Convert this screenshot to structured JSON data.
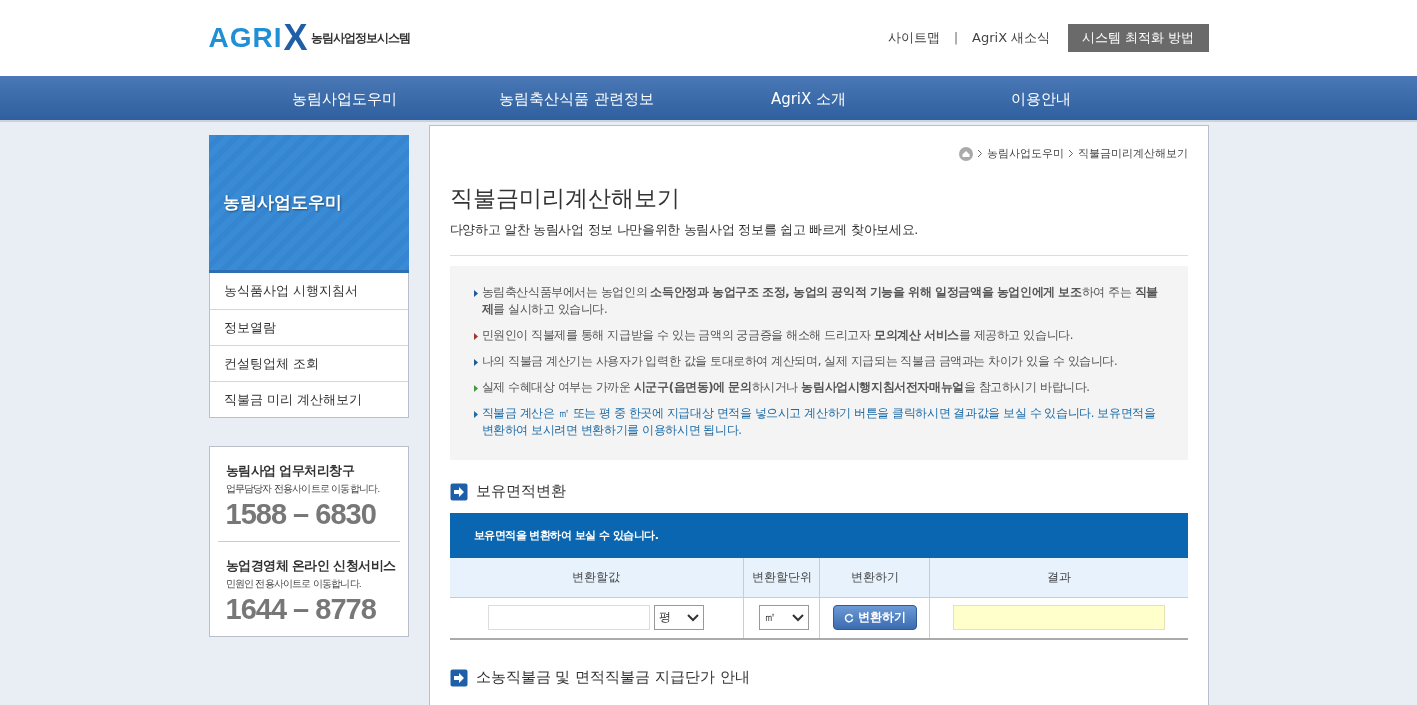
{
  "header": {
    "logo": {
      "wordmark": "AGRI",
      "x_letter": "X",
      "subtitle": "농림사업정보시스템"
    },
    "utility_links": [
      "사이트맵",
      "AgriX 새소식"
    ],
    "utility_separator": "|",
    "optimize_button": "시스템 최적화 방법"
  },
  "nav": [
    "농림사업도우미",
    "농림축산식품 관련정보",
    "AgriX 소개",
    "이용안내"
  ],
  "sidebar": {
    "title": "농림사업도우미",
    "items": [
      {
        "label": "농식품사업 시행지침서",
        "selected": false
      },
      {
        "label": "정보열람",
        "selected": false
      },
      {
        "label": "컨설팅업체 조회",
        "selected": false
      },
      {
        "label": "직불금 미리 계산해보기",
        "selected": false
      }
    ],
    "contacts": [
      {
        "title": "농림사업 업무처리창구",
        "subtitle": "업무담당자 전용사이트로 이동합니다.",
        "phone": "1588 – 6830"
      },
      {
        "title": "농업경영체 온라인 신청서비스",
        "subtitle": "민원인 전용사이트로 이동합니다.",
        "phone": "1644 – 8778"
      }
    ]
  },
  "breadcrumb": [
    "농림사업도우미",
    "직불금미리계산해보기"
  ],
  "page_title": "직불금미리계산해보기",
  "page_description": "다양하고 알찬 농림사업 정보 나만을위한 농림사업 정보를 쉽고 빠르게 찾아보세요.",
  "notes": [
    {
      "kind": "plain",
      "color": "#1d5a96",
      "text": "농림축산식품부에서는 농업인의 **소득안정과 농업구조 조정, 농업의 공익적 기능을 위해 일정금액을 농업인에게 보조**하여 주는 **직불제**를 실시하고 있습니다."
    },
    {
      "kind": "plain",
      "color": "#a5352c",
      "text": "민원인이 직불제를 통해 지급받을 수 있는 금액의 궁금증을 해소해 드리고자 **모의계산 서비스**를 제공하고 있습니다."
    },
    {
      "kind": "plain",
      "color": "#1d5a96",
      "text": "나의 직불금 계산기는 사용자가 입력한 값을 토대로하여 계산되며, 실제 지급되는 직불금 금액과는 차이가 있을 수 있습니다."
    },
    {
      "kind": "plain",
      "color": "#3f9a3a",
      "text": "실제 수혜대상 여부는 가까운 **시군구(읍면동)에 문의**하시거나 **농림사업시행지침서전자매뉴얼**을 참고하시기 바랍니다."
    },
    {
      "kind": "highlight",
      "color": "#1d6aa5",
      "text": "직불금 계산은 ㎡ 또는 평 중 한곳에 지급대상 면적을 넣으시고 계산하기 버튼을 클릭하시면 결과값을 보실 수 있습니다. 보유면적을 변환하여 보시려면 변환하기를 이용하시면 됩니다."
    }
  ],
  "converter": {
    "heading": "보유면적변환",
    "banner": "보유면적을 변환하여 보실 수 있습니다.",
    "columns": [
      "변환할값",
      "변환할단위",
      "변환하기",
      "결과"
    ],
    "from_unit": "평",
    "to_unit": "㎡",
    "convert_button": "변환하기"
  },
  "next_heading": "소농직불금 및 면적직불금 지급단가 안내"
}
